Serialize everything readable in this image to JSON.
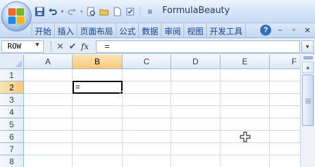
{
  "window": {
    "title": "FormulaBeauty",
    "title_menu_glyph": "≡"
  },
  "ribbon": {
    "tabs": [
      "开始",
      "插入",
      "页面布局",
      "公式",
      "数据",
      "审阅",
      "视图",
      "开发工具"
    ],
    "help_label": "?",
    "minimize_glyph": "–",
    "restore_glyph": "▫",
    "close_glyph": "✕"
  },
  "formula_bar": {
    "name_box": "ROW",
    "cancel_glyph": "✕",
    "enter_glyph": "✔",
    "fx_label": "fx",
    "content": "="
  },
  "sheet": {
    "columns": [
      "A",
      "B",
      "C",
      "D",
      "E",
      "F"
    ],
    "rows": [
      "1",
      "2",
      "3",
      "4",
      "5",
      "6",
      "7",
      "8"
    ],
    "active_column": "B",
    "active_row": "2",
    "active_cell_content": "="
  },
  "colors": {
    "accent": "#15428b",
    "header_highlight": "#f8c97a",
    "grid_line": "#d0d7e5"
  }
}
